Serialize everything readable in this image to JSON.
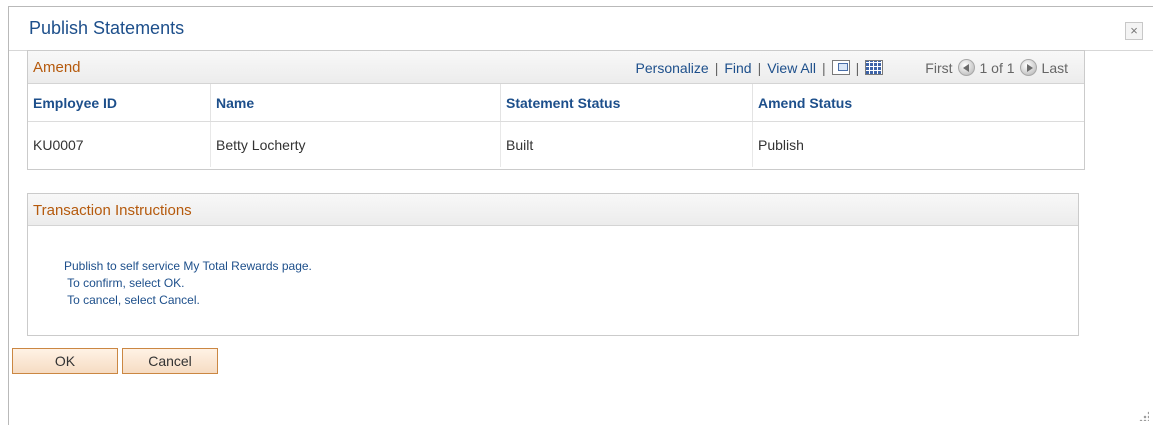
{
  "dialog": {
    "title": "Publish Statements",
    "close_label": "×"
  },
  "grid": {
    "title": "Amend",
    "nav": {
      "personalize": "Personalize",
      "find": "Find",
      "view_all": "View All",
      "first": "First",
      "range": "1 of 1",
      "last": "Last"
    },
    "columns": [
      "Employee ID",
      "Name",
      "Statement Status",
      "Amend Status"
    ],
    "rows": [
      [
        "KU0007",
        "Betty Locherty",
        "Built",
        "Publish"
      ]
    ]
  },
  "instructions": {
    "title": "Transaction Instructions",
    "lines": [
      "Publish to self service My Total Rewards page.",
      " To confirm, select OK.",
      " To cancel, select Cancel."
    ]
  },
  "buttons": {
    "ok": "OK",
    "cancel": "Cancel"
  },
  "colors": {
    "title_blue": "#1d4f8b",
    "section_orange": "#b55a0d",
    "button_border": "#cb8742"
  }
}
